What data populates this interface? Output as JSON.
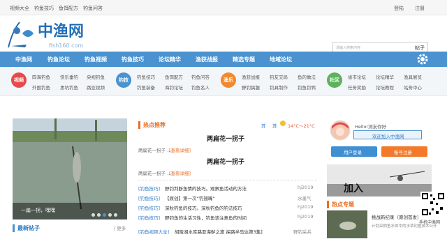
{
  "topbar": {
    "links": [
      "视频大全",
      "钓鱼技巧",
      "鱼饵配方",
      "钓鱼问答"
    ],
    "login": "登陆",
    "register": "注册"
  },
  "logo": {
    "text": "中渔网",
    "sub": "fish160.com"
  },
  "search": {
    "placeholder": "请输入搜索内容",
    "button": "帖子"
  },
  "nav": [
    "中渔网",
    "钓鱼论坛",
    "钓鱼视频",
    "钓鱼技巧",
    "论坛精华",
    "渔获战报",
    "精选专题",
    "地域论坛"
  ],
  "cats": [
    {
      "label": "视频",
      "color": "#e64a4a",
      "links": [
        [
          "四海钓鱼",
          "快乐垂钓",
          "央视钓鱼"
        ],
        [
          "外国钓鱼",
          "黑坑钓鱼",
          "路亚视频"
        ]
      ]
    },
    {
      "label": "钓技",
      "color": "#4a93d0",
      "links": [
        [
          "钓鱼技巧",
          "鱼饵配方",
          "钓鱼问答"
        ],
        [
          "钓鱼装备",
          "海钓论坛",
          "钓鱼名人"
        ]
      ]
    },
    {
      "label": "渔乐",
      "color": "#f08a2f",
      "links": [
        [
          "渔获战报",
          "钓友交局",
          "鱼的做法"
        ],
        [
          "野钓搞趣",
          "钓具制作",
          "钓鱼钓鸭"
        ]
      ]
    },
    {
      "label": "社区",
      "color": "#5bb35b",
      "links": [
        [
          "省市论坛",
          "论坛精华",
          "渔具展览"
        ],
        [
          "任务奖励",
          "论坛教程",
          "站务中心"
        ]
      ]
    }
  ],
  "photo": {
    "caption": "一扁一拐，嘿嘿"
  },
  "latest": {
    "title": "最新帖子",
    "more": "| 更多"
  },
  "hot": {
    "title": "热点推荐",
    "topic1": "两扁花一拐子",
    "topic1_sub": "两扁花一拐子 ...",
    "topic1_detail": "[查看详细]",
    "topic2": "两扁花一拐子",
    "topic2_sub": "两扁花一拐子 ...",
    "topic2_detail": "[查看详细]"
  },
  "weather": {
    "city": "苏",
    "prov": "苏",
    "temp": "14°C～21°C"
  },
  "list": [
    {
      "cat": "[钓鱼技巧]",
      "title": "野钓判断鱼情的技巧。观察鱼活动的方法",
      "author": "hj2019"
    },
    {
      "cat": "[钓鱼技巧]",
      "title": "【原创】第一次“钓翘嘴”",
      "author": "水墨气"
    },
    {
      "cat": "[钓鱼技巧]",
      "title": "深秋钓鱼的技巧。深秋钓鱼的钓法技巧",
      "author": "hj2019"
    },
    {
      "cat": "[钓鱼技巧]",
      "title": "野钓鱼的生活习性，钓鱼该注意鱼的时间",
      "author": "hj2019"
    },
    {
      "cat": "[钓鱼视频大全]",
      "title": "胡陵湖水库路亚海鲈之旅 探路半岛达第3集]",
      "author": "野钓采兵"
    }
  ],
  "user": {
    "hello": "Hello!测友你好",
    "welcome": "欢迎加入中渔网",
    "login_btn": "用户登录",
    "reg_btn": "账号注册"
  },
  "banner": {
    "text": "加入"
  },
  "special": {
    "title": "热点专题",
    "item_title": "挑战新纪录（原创首发）",
    "item_desc": "计划采购鱼水体中的水草钓鱼技术公开"
  },
  "qr": {
    "label": "手机中渔网"
  }
}
